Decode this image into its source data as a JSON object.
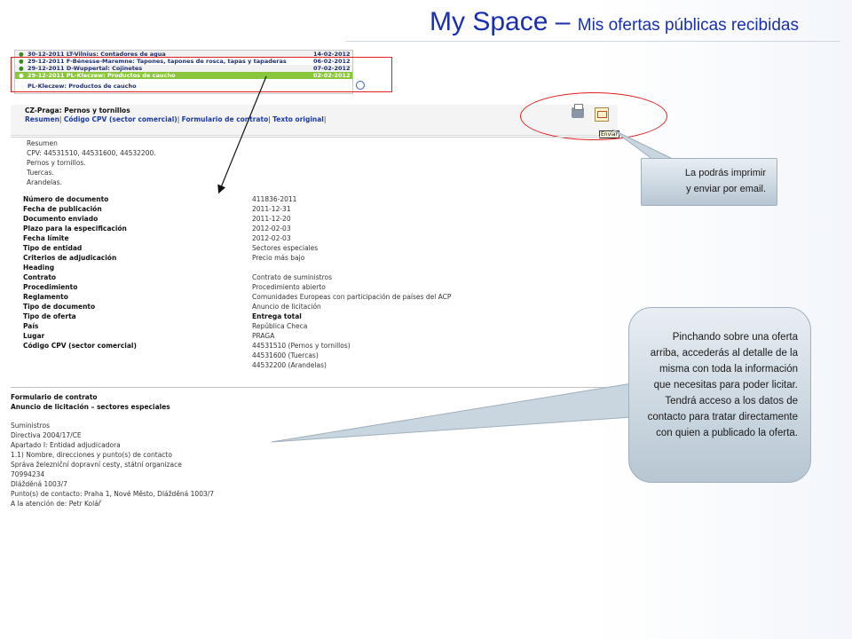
{
  "slide": {
    "title_main": "My Space",
    "title_dash": " – ",
    "title_sub": "Mis ofertas públicas recibidas"
  },
  "offers_list": {
    "rows": [
      {
        "title": "30-12-2011  LT-Vilnius: Contadores de agua",
        "date": "14-02-2012",
        "selected": false
      },
      {
        "title": "29-12-2011  F-Bénesse-Maremne: Tapones, tapones de rosca, tapas y tapaderas",
        "date": "06-02-2012",
        "selected": false
      },
      {
        "title": "29-12-2011  D-Wuppertal: Cojinetes",
        "date": "07-02-2012",
        "selected": false
      },
      {
        "title": "29-12-2011  PL-Kleczew: Productos de caucho",
        "date": "02-02-2012",
        "selected": true
      }
    ],
    "footer": "PL-Kleczew: Productos de caucho",
    "zoom_icon": "magnifier-icon"
  },
  "detail": {
    "title": "CZ-Praga: Pernos y tornillos",
    "links": [
      "Resumen",
      "Código CPV (sector comercial)",
      "Formulario de contrato",
      "Texto original"
    ],
    "print_icon": "printer-icon",
    "mail_icon": "envelope-icon",
    "mail_tooltip": "Enviar",
    "summary_lines": [
      "Resumen",
      "CPV: 44531510, 44531600, 44532200.",
      "Pernos y tornillos.",
      "Tuercas.",
      "Arandelas."
    ],
    "fields": [
      {
        "label": "Número de documento",
        "value": "411836-2011"
      },
      {
        "label": "Fecha de publicación",
        "value": "2011-12-31"
      },
      {
        "label": "Documento enviado",
        "value": "2011-12-20"
      },
      {
        "label": "Plazo para la especificación",
        "value": "2012-02-03"
      },
      {
        "label": "Fecha límite",
        "value": "2012-02-03"
      },
      {
        "label": "Tipo de entidad",
        "value": "Sectores especiales"
      },
      {
        "label": "Criterios de adjudicación",
        "value": "Precio más bajo"
      },
      {
        "label": "Heading",
        "value": ""
      },
      {
        "label": "Contrato",
        "value": "Contrato de suministros"
      },
      {
        "label": "Procedimiento",
        "value": "Procedimiento abierto"
      },
      {
        "label": "Reglamento",
        "value": "Comunidades Europeas con participación de países del ACP"
      },
      {
        "label": "Tipo de documento",
        "value": "Anuncio de licitación"
      },
      {
        "label": "Tipo de oferta",
        "value": "Entrega total"
      },
      {
        "label": "País",
        "value": "República Checa"
      },
      {
        "label": "Lugar",
        "value": "PRAGA"
      },
      {
        "label": "Código CPV (sector comercial)",
        "value": "44531510 (Pernos y tornillos)"
      }
    ],
    "cpv_extra": [
      "44531600 (Tuercas)",
      "44532200 (Arandelas)"
    ],
    "form_title": [
      "Formulario de contrato",
      "Anuncio de licitación – sectores especiales"
    ],
    "form_lines": [
      "Suministros",
      "Directiva 2004/17/CE",
      "Apartado I: Entidad adjudicadora",
      "1.1) Nombre, direcciones y punto(s) de contacto",
      "Správa železniční dopravní cesty, státní organizace",
      "70994234",
      "Dlážděná 1003/7",
      "Punto(s) de contacto: Praha 1, Nové Město, Dlážděná 1003/7",
      "A la atención de: Petr Kolář"
    ]
  },
  "callouts": {
    "small": [
      "La podrás imprimir",
      "y enviar por email."
    ],
    "big": "Pinchando sobre una oferta arriba, accederás al detalle de la misma con toda la información que necesitas para poder licitar. Tendrá acceso a los datos de contacto para tratar directamente con quien a publicado la oferta."
  },
  "colors": {
    "title": "#1a2fb0",
    "selected_row": "#8ac63b",
    "highlight": "#e02020",
    "link": "#1b3aa8"
  }
}
